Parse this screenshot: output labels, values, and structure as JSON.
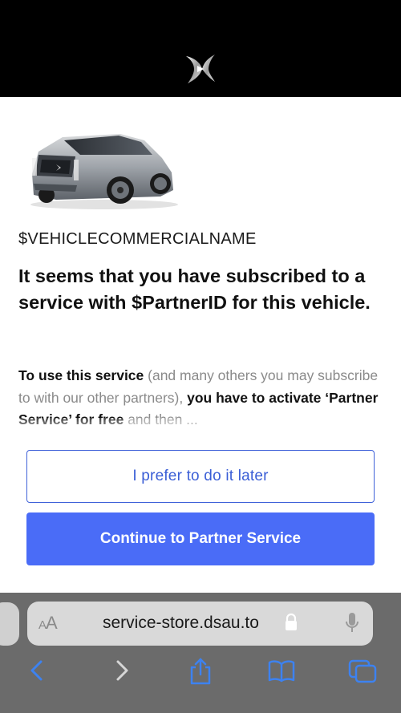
{
  "header": {
    "logo_icon": "ds-automobiles-logo-icon"
  },
  "content": {
    "car_image": "concept-car-image",
    "vehicle_name": "$VEHICLECOMMERCIALNAME",
    "headline": "It seems that you have subscribed to a service with $PartnerID for this vehicle.",
    "body": {
      "part1_bold": "To use this service",
      "part2": " (and many others you may subscribe to with our other partners), ",
      "part3_bold": "you have to activate ‘Partner Service’ for free",
      "part4": " and then ..."
    }
  },
  "actions": {
    "later_label": "I prefer to do it later",
    "continue_label": "Continue to Partner Service"
  },
  "browser": {
    "text_size_label_small": "A",
    "text_size_label_large": "A",
    "url": "service-store.dsau.to",
    "icons": {
      "lock": "lock-icon",
      "mic": "microphone-icon",
      "back": "back-icon",
      "forward": "forward-icon",
      "share": "share-icon",
      "bookmarks": "bookmarks-icon",
      "tabs": "tabs-icon"
    }
  },
  "colors": {
    "header_bg": "#000000",
    "accent": "#4a6cf7",
    "outline_blue": "#3f61d9",
    "muted_text": "#8a8a8a",
    "safari_bar": "#6b6b6b",
    "safari_icon": "#3d82f0"
  }
}
